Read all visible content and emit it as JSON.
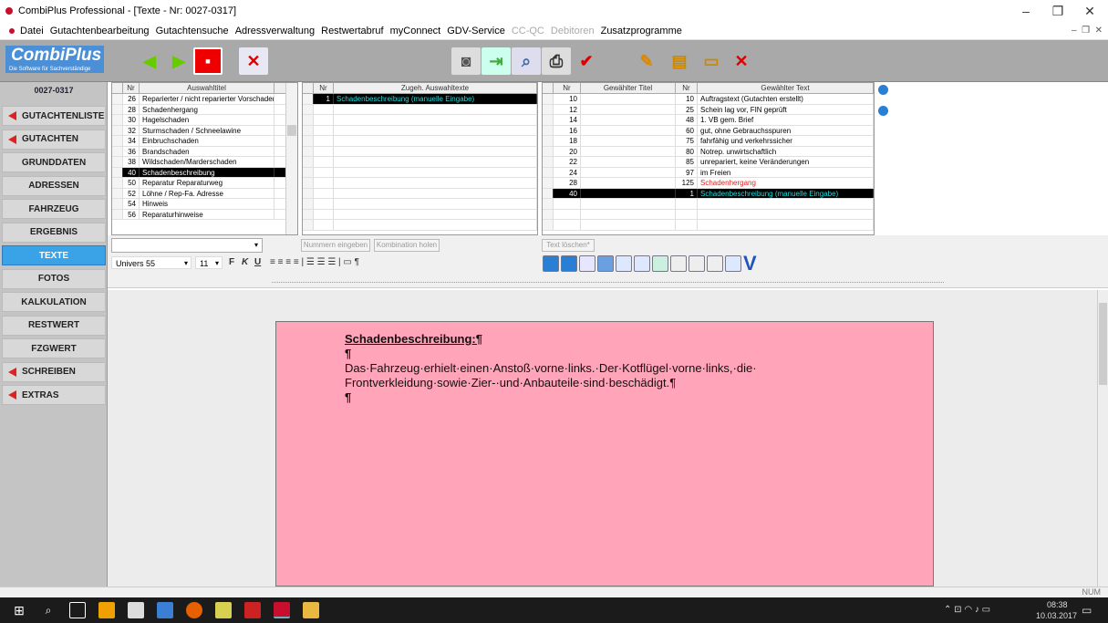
{
  "window": {
    "title": "CombiPlus Professional - [Texte - Nr: 0027-0317]"
  },
  "menu": [
    "Datei",
    "Gutachtenbearbeitung",
    "Gutachtensuche",
    "Adressverwaltung",
    "Restwertabruf",
    "myConnect",
    "GDV-Service",
    "CC-QC",
    "Debitoren",
    "Zusatzprogramme"
  ],
  "menu_disabled": [
    "CC-QC",
    "Debitoren"
  ],
  "logo": {
    "name": "CombiPlus",
    "tagline": "Die Software für Sachverständige"
  },
  "sidebar": {
    "code": "0027-0317",
    "items": [
      {
        "label": "GUTACHTENLISTE",
        "marker": true
      },
      {
        "label": "GUTACHTEN",
        "marker": true
      },
      {
        "label": "GRUNDDATEN",
        "marker": false
      },
      {
        "label": "ADRESSEN",
        "marker": false
      },
      {
        "label": "FAHRZEUG",
        "marker": false
      },
      {
        "label": "ERGEBNIS",
        "marker": false
      },
      {
        "label": "TEXTE",
        "marker": false,
        "active": true
      },
      {
        "label": "FOTOS",
        "marker": false
      },
      {
        "label": "KALKULATION",
        "marker": false
      },
      {
        "label": "RESTWERT",
        "marker": false
      },
      {
        "label": "FZGWERT",
        "marker": false
      },
      {
        "label": "SCHREIBEN",
        "marker": true
      },
      {
        "label": "EXTRAS",
        "marker": true
      }
    ]
  },
  "grid1": {
    "headers": [
      "Nr",
      "Auswahltitel"
    ],
    "rows": [
      [
        "26",
        "Reparierter / nicht reparierter Vorschaden"
      ],
      [
        "28",
        "Schadenhergang"
      ],
      [
        "30",
        "Hagelschaden"
      ],
      [
        "32",
        "Sturmschaden / Schneelawine"
      ],
      [
        "34",
        "Einbruchschaden"
      ],
      [
        "36",
        "Brandschaden"
      ],
      [
        "38",
        "Wildschaden/Marderschaden"
      ],
      [
        "40",
        "Schadenbeschreibung"
      ],
      [
        "50",
        "Reparatur Reparaturweg"
      ],
      [
        "52",
        "Löhne / Rep-Fa. Adresse"
      ],
      [
        "54",
        "Hinweis"
      ],
      [
        "56",
        "Reparaturhinweise"
      ]
    ],
    "selected": 7
  },
  "grid2": {
    "headers": [
      "Nr",
      "Zugeh. Auswahltexte"
    ],
    "rows": [
      [
        "1",
        "Schadenbeschreibung (manuelle Eingabe)"
      ]
    ]
  },
  "grid3": {
    "headers": [
      "Nr",
      "Gewählter Titel",
      "Nr",
      "Gewählter Text"
    ],
    "rows": [
      [
        "10",
        "",
        "10",
        "Auftragstext (Gutachten erstellt)"
      ],
      [
        "12",
        "",
        "25",
        "Schein lag vor, FIN geprüft"
      ],
      [
        "14",
        "",
        "48",
        "1. VB gem. Brief"
      ],
      [
        "16",
        "",
        "60",
        "gut, ohne Gebrauchsspuren"
      ],
      [
        "18",
        "",
        "75",
        "fahrfähig und verkehrssicher"
      ],
      [
        "20",
        "",
        "80",
        "Notrep. unwirtschaftlich"
      ],
      [
        "22",
        "",
        "85",
        "unrepariert, keine Veränderungen"
      ],
      [
        "24",
        "",
        "97",
        "im Freien"
      ],
      [
        "28",
        "",
        "125",
        "Schadenhergang"
      ],
      [
        "40",
        "",
        "1",
        "Schadenbeschreibung (manuelle Eingabe)"
      ]
    ],
    "selected": 9,
    "red_row": 8
  },
  "form": {
    "btn_nummern": "Nummern eingeben",
    "btn_kombination": "Kombination holen",
    "btn_text_loeschen": "Text löschen*"
  },
  "format": {
    "font": "Univers 55",
    "size": "11",
    "bold": "F",
    "italic": "K",
    "underline": "U"
  },
  "document": {
    "lines": [
      "Schadenbeschreibung:¶",
      "¶",
      "Das·Fahrzeug·erhielt·einen·Anstoß·vorne·links.·Der·Kotflügel·vorne·links,·die·",
      "Frontverkleidung·sowie·Zier-·und·Anbauteile·sind·beschädigt.¶",
      "¶"
    ]
  },
  "status": {
    "num": "NUM"
  },
  "taskbar": {
    "time": "08:38",
    "date": "10.03.2017"
  },
  "colors": {
    "toolbar": "#a9a9a9",
    "sidebar": "#c4c4c4",
    "active": "#3aa3e8",
    "page": "#ffa4b9",
    "taskbar": "#1b1b1b"
  }
}
